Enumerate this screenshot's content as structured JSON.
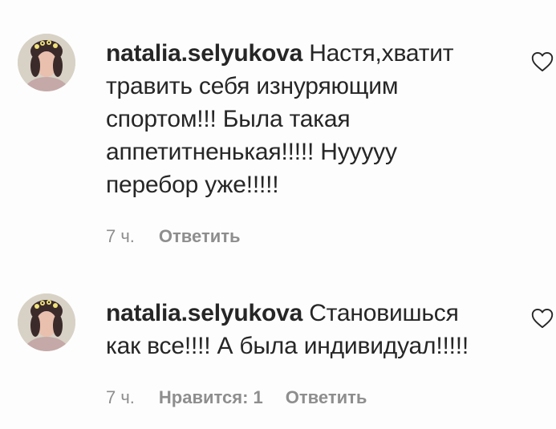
{
  "comments": [
    {
      "username": "natalia.selyukova",
      "text_lines": [
        " Настя,хватит",
        "травить себя изнуряющим",
        "спортом!!! Была такая",
        "аппетитненькая!!!!! Нууууу",
        "перебор уже!!!!!"
      ],
      "time": "7 ч.",
      "reply_label": "Ответить",
      "like_icon": "heart-outline-icon"
    },
    {
      "username": "natalia.selyukova",
      "text_lines": [
        " Становишься",
        "как все!!!! А была индивидуал!!!!!"
      ],
      "time": "7 ч.",
      "likes_label": "Нравится: 1",
      "reply_label": "Ответить",
      "like_icon": "heart-outline-icon"
    }
  ],
  "colors": {
    "text": "#262626",
    "meta": "#8e8e8e",
    "background": "#fdfdfd"
  }
}
